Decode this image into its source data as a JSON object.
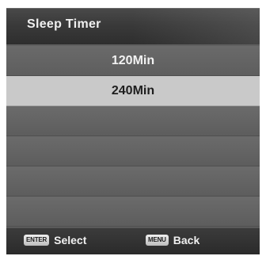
{
  "window": {
    "title": "Sleep Timer"
  },
  "menu": {
    "items": [
      {
        "label": "120Min",
        "selected": false
      },
      {
        "label": "240Min",
        "selected": true
      },
      {
        "label": "",
        "selected": false
      },
      {
        "label": "",
        "selected": false
      },
      {
        "label": "",
        "selected": false
      },
      {
        "label": "",
        "selected": false
      }
    ]
  },
  "footer": {
    "select_key": "ENTER",
    "select_label": "Select",
    "back_key": "MENU",
    "back_label": "Back"
  },
  "colors": {
    "panel": "#5f5f5f",
    "title_bar": "#333333",
    "selected_row": "#c9c9c9",
    "text": "#f2f2f2"
  }
}
